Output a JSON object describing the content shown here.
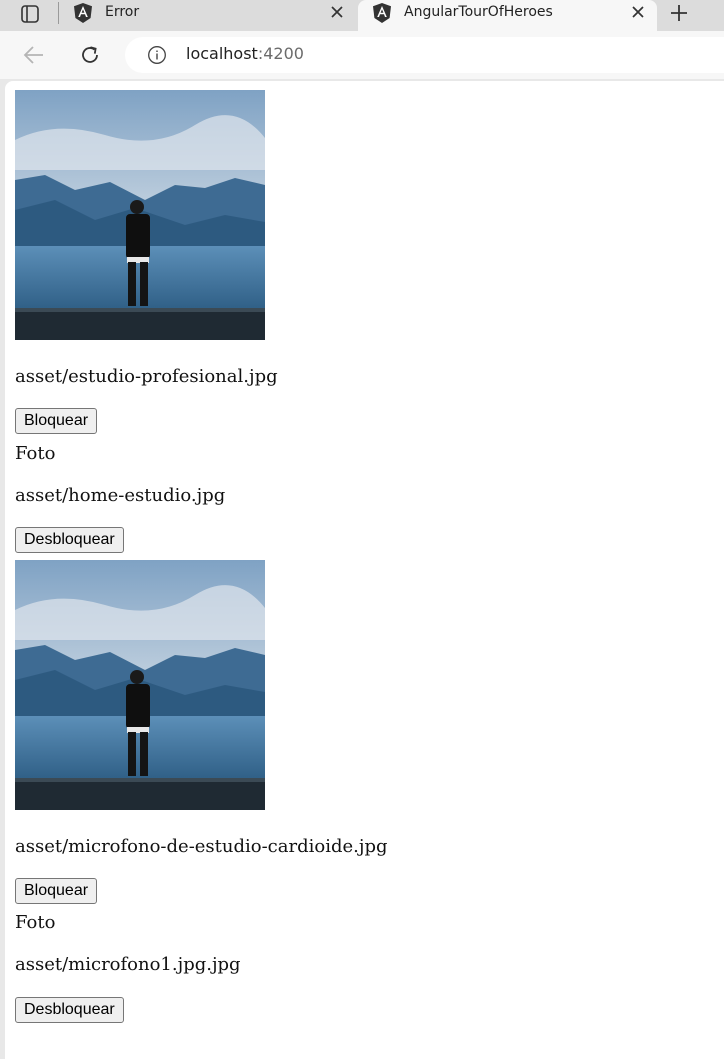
{
  "browser": {
    "tabs": [
      {
        "title": "Error"
      },
      {
        "title": "AngularTourOfHeroes"
      }
    ],
    "address": {
      "host": "localhost",
      "port": ":4200"
    }
  },
  "page": {
    "items": [
      {
        "image": {
          "visible": true,
          "alt": ""
        },
        "path": "asset/estudio-profesional.jpg",
        "button": "Bloquear"
      },
      {
        "image": {
          "visible": false,
          "alt": "Foto"
        },
        "path": "asset/home-estudio.jpg",
        "button": "Desbloquear"
      },
      {
        "image": {
          "visible": true,
          "alt": ""
        },
        "path": "asset/microfono-de-estudio-cardioide.jpg",
        "button": "Bloquear"
      },
      {
        "image": {
          "visible": false,
          "alt": "Foto"
        },
        "path": "asset/microfono1.jpg.jpg",
        "button": "Desbloquear"
      }
    ]
  }
}
